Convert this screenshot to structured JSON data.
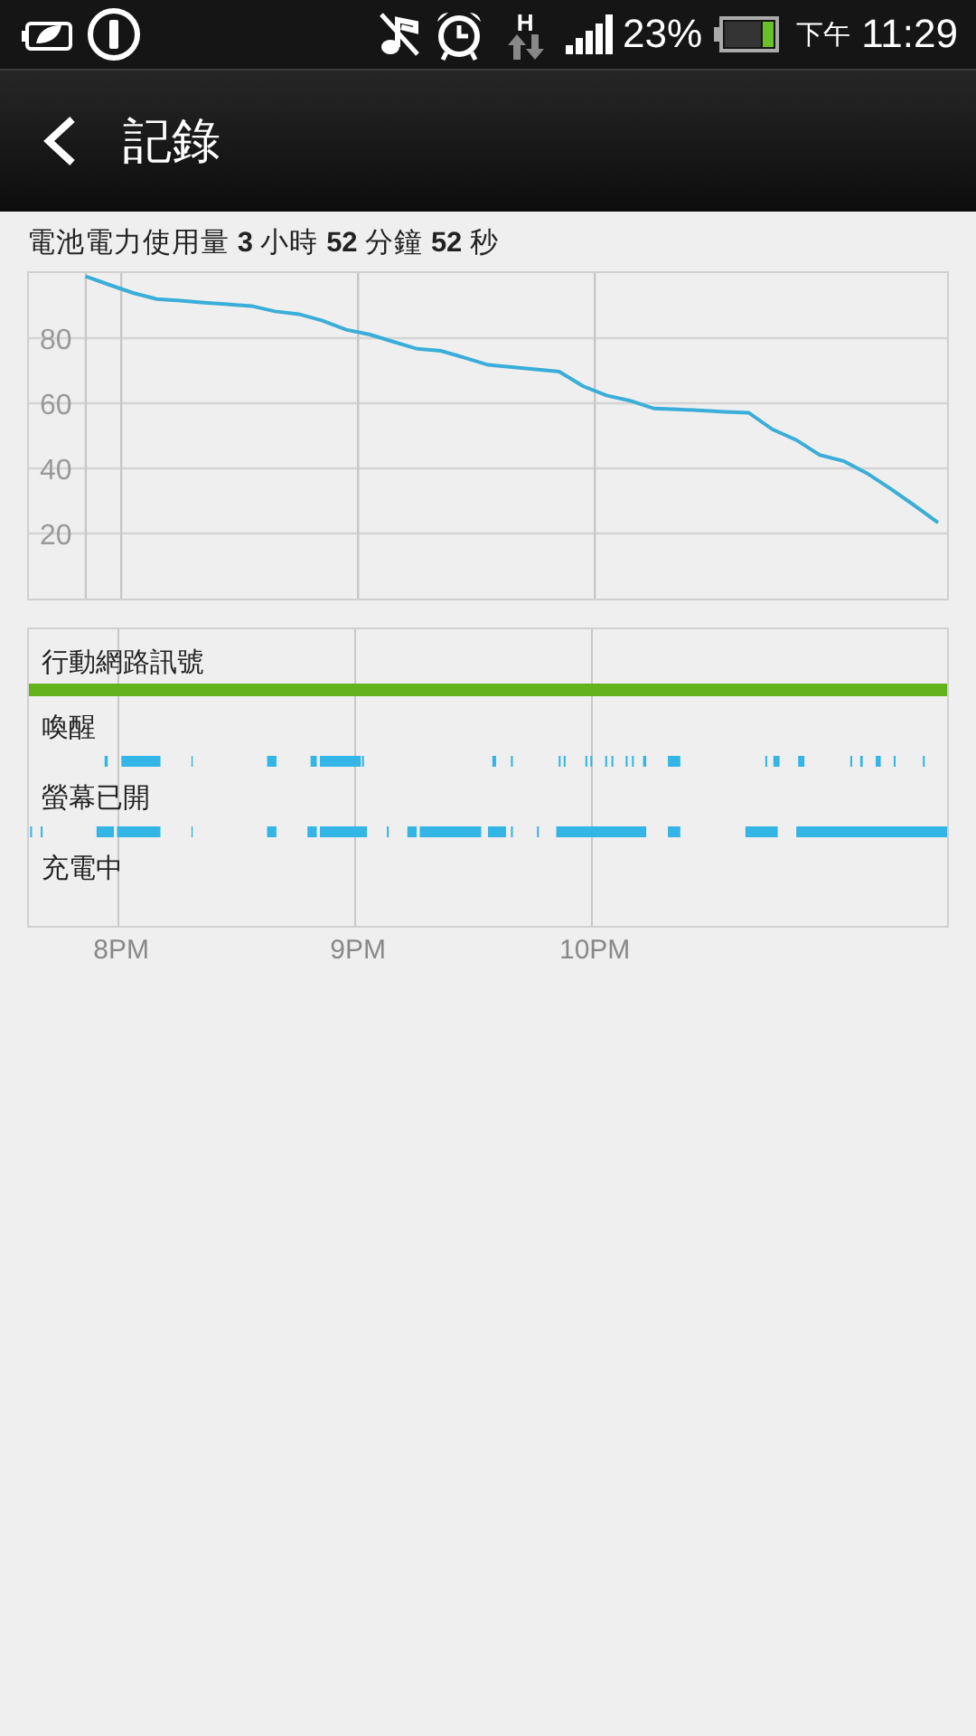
{
  "status_bar": {
    "network_type": "H",
    "battery_percent": "23%",
    "meridiem": "下午",
    "time": "11:29"
  },
  "header": {
    "title": "記錄"
  },
  "usage_summary": "電池電力使用量 **3** 小時 **52** 分鐘 **52** 秒",
  "battery_chart": {
    "chart_data": {
      "type": "line",
      "categories": [
        null,
        null,
        null,
        null,
        null,
        null,
        null,
        null,
        null,
        null,
        null,
        null,
        null,
        null,
        null,
        null,
        null,
        null,
        null,
        null,
        null,
        null,
        null,
        null,
        null,
        null,
        null,
        null,
        null,
        null,
        null,
        null,
        null,
        null,
        null,
        null,
        null
      ],
      "series": [
        {
          "color": "#3aaed8",
          "values": [
            99,
            96.4,
            93.9,
            92,
            91.5,
            90.9,
            90.4,
            89.9,
            88.2,
            87.4,
            85.4,
            82.6,
            81.1,
            78.9,
            76.7,
            76.1,
            74,
            71.8,
            71.1,
            70.4,
            69.7,
            65.3,
            62.4,
            60.8,
            58.4,
            58.1,
            57.8,
            57.4,
            57.1,
            52,
            48.8,
            44.1,
            42.3,
            38.5,
            33.7,
            28.6,
            23.3
          ]
        }
      ],
      "ylim": [
        0,
        100
      ],
      "yticks": [
        20,
        40,
        60,
        80
      ],
      "grid": true
    }
  },
  "timeline": {
    "rows": [
      {
        "label": "行動網路訊號",
        "kind": "signal"
      },
      {
        "label": "喚醒",
        "kind": "wake"
      },
      {
        "label": "螢幕已開",
        "kind": "screen"
      },
      {
        "label": "充電中",
        "kind": "charging"
      }
    ],
    "time_labels": [
      "8PM",
      "9PM",
      "10PM"
    ]
  }
}
